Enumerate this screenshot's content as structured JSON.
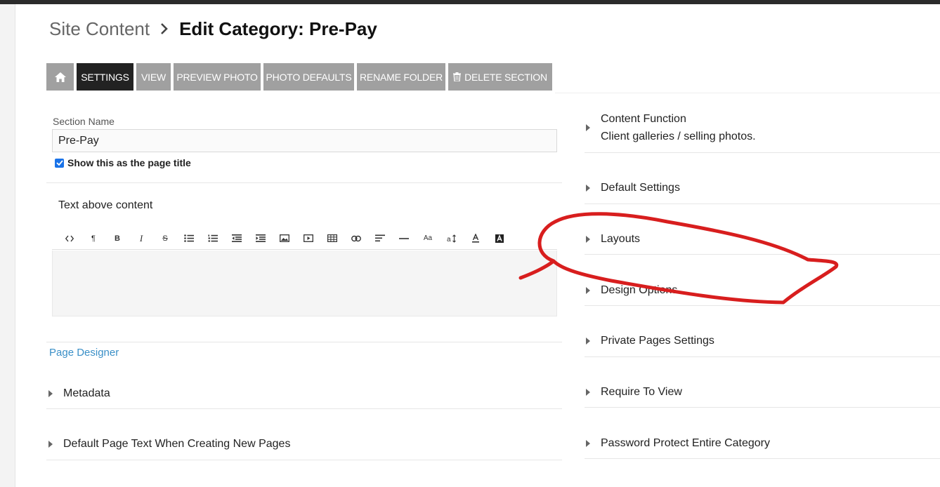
{
  "breadcrumb": {
    "root": "Site Content",
    "title": "Edit Category: Pre-Pay"
  },
  "toolbar": {
    "home_icon": "home-icon",
    "buttons": [
      {
        "label": "SETTINGS",
        "active": true
      },
      {
        "label": "VIEW"
      },
      {
        "label": "PREVIEW PHOTO"
      },
      {
        "label": "PHOTO DEFAULTS"
      },
      {
        "label": "RENAME FOLDER"
      },
      {
        "label": "DELETE SECTION",
        "icon": "trash-icon"
      }
    ]
  },
  "form": {
    "section_name_label": "Section Name",
    "section_name_value": "Pre-Pay",
    "show_title_label": "Show this as the page title",
    "show_title_checked": true,
    "text_above_label": "Text above content",
    "page_designer_link": "Page Designer"
  },
  "editor_toolbar": [
    "code-view-icon",
    "paragraph-icon",
    "bold-icon",
    "italic-icon",
    "strikethrough-icon",
    "bullet-list-icon",
    "numbered-list-icon",
    "outdent-icon",
    "indent-icon",
    "image-icon",
    "video-icon",
    "table-icon",
    "link-icon",
    "align-icon",
    "horizontal-rule-icon",
    "font-size-icon",
    "line-height-icon",
    "text-color-icon",
    "background-color-icon"
  ],
  "left_sections": [
    {
      "label": "Metadata"
    },
    {
      "label": "Default Page Text When Creating New Pages"
    }
  ],
  "right_sections": [
    {
      "label": "Content Function",
      "value": "Client galleries / selling photos."
    },
    {
      "label": "Default Settings"
    },
    {
      "label": "Layouts"
    },
    {
      "label": "Design Options"
    },
    {
      "label": "Private Pages Settings"
    },
    {
      "label": "Require To View"
    },
    {
      "label": "Password Protect Entire Category"
    }
  ],
  "colors": {
    "toolbar_button": "#a0a0a0",
    "toolbar_active": "#222222",
    "link": "#3a8fc7",
    "annotation": "#d81e1e"
  }
}
